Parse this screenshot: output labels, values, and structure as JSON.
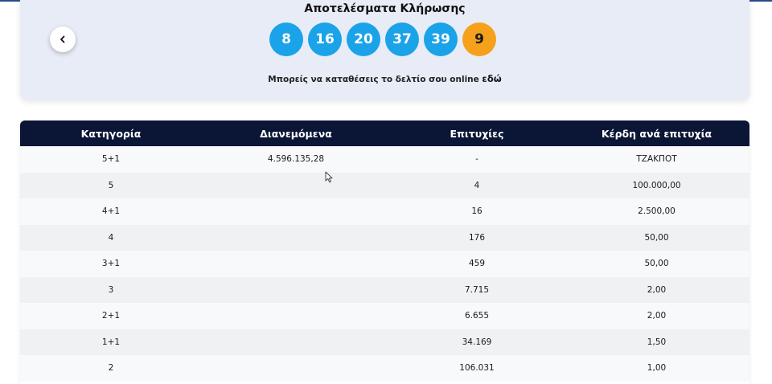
{
  "results": {
    "title": "Αποτελέσματα Κλήρωσης",
    "main_numbers": [
      "8",
      "16",
      "20",
      "37",
      "39"
    ],
    "bonus_number": "9",
    "online_note_text": "Μπορείς να καταθέσεις το δελτίο σου online",
    "online_note_link": "εδώ",
    "back_icon": "chevron-left-icon"
  },
  "colors": {
    "main_ball": "#1aa3e8",
    "bonus_ball": "#f5a11c",
    "table_header": "#0b1535"
  },
  "table": {
    "headers": [
      "Κατηγορία",
      "Διανεμόμενα",
      "Επιτυχίες",
      "Κέρδη ανά επιτυχία"
    ],
    "rows": [
      [
        "5+1",
        "4.596.135,28",
        "-",
        "ΤΖΑΚΠΟΤ"
      ],
      [
        "5",
        "",
        "4",
        "100.000,00"
      ],
      [
        "4+1",
        "",
        "16",
        "2.500,00"
      ],
      [
        "4",
        "",
        "176",
        "50,00"
      ],
      [
        "3+1",
        "",
        "459",
        "50,00"
      ],
      [
        "3",
        "",
        "7.715",
        "2,00"
      ],
      [
        "2+1",
        "",
        "6.655",
        "2,00"
      ],
      [
        "1+1",
        "",
        "34.169",
        "1,50"
      ],
      [
        "2",
        "",
        "106.031",
        "1,00"
      ]
    ]
  }
}
